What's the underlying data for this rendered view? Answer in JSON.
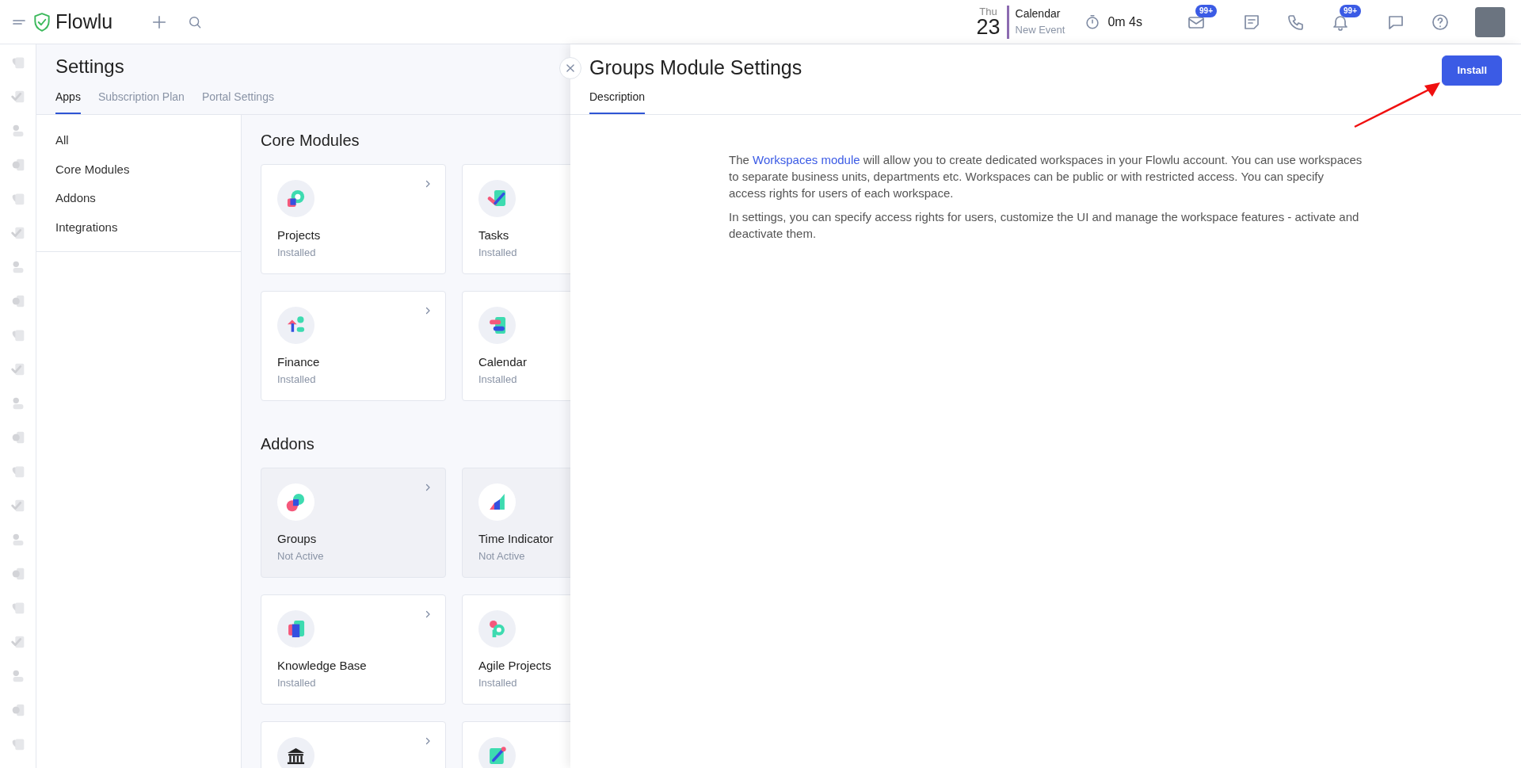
{
  "topbar": {
    "brand": "Flowlu",
    "date": {
      "weekday": "Thu",
      "day": "23"
    },
    "calendar": {
      "title": "Calendar",
      "action": "New Event"
    },
    "timer": "0m 4s",
    "mail_badge": "99+",
    "notifications_badge": "99+"
  },
  "settings": {
    "title": "Settings",
    "tabs": [
      {
        "label": "Apps",
        "selected": true
      },
      {
        "label": "Subscription Plan",
        "selected": false
      },
      {
        "label": "Portal Settings",
        "selected": false
      }
    ],
    "filters": [
      "All",
      "Core Modules",
      "Addons",
      "Integrations"
    ],
    "sections": [
      {
        "title": "Core Modules",
        "cards": [
          {
            "name": "Projects",
            "status": "Installed",
            "selected": false,
            "arrow": true
          },
          {
            "name": "Tasks",
            "status": "Installed",
            "selected": false,
            "arrow": false
          },
          {
            "name": "Finance",
            "status": "Installed",
            "selected": false,
            "arrow": true
          },
          {
            "name": "Calendar",
            "status": "Installed",
            "selected": false,
            "arrow": false
          }
        ]
      },
      {
        "title": "Addons",
        "cards": [
          {
            "name": "Groups",
            "status": "Not Active",
            "selected": true,
            "arrow": true
          },
          {
            "name": "Time Indicator",
            "status": "Not Active",
            "selected": true,
            "arrow": false
          },
          {
            "name": "Knowledge Base",
            "status": "Installed",
            "selected": false,
            "arrow": true
          },
          {
            "name": "Agile Projects",
            "status": "Installed",
            "selected": false,
            "arrow": false
          },
          {
            "selected": false,
            "arrow": true
          },
          {
            "selected": false,
            "arrow": false
          }
        ]
      }
    ]
  },
  "panel": {
    "title": "Groups Module Settings",
    "tabs": [
      {
        "label": "Description",
        "selected": true
      }
    ],
    "button": "Install",
    "paragraphs": [
      {
        "before": "The ",
        "link": "Workspaces module",
        "after": " will allow you to create dedicated workspaces in your Flowlu account. You can use workspaces to separate business units, departments etc. Workspaces can be public or with restricted access. You can specify access rights for users of each workspace."
      },
      {
        "before": "In settings, you can specify access rights for users, customize the UI and manage the workspace features - activate and deactivate them."
      }
    ]
  }
}
